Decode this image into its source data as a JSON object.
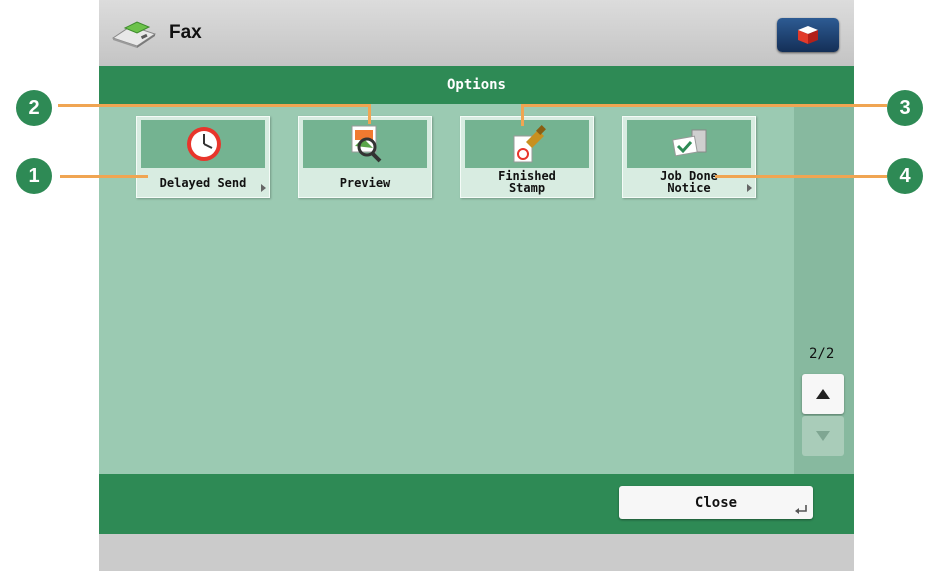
{
  "header": {
    "title": "Fax",
    "app_icon": "fax-machine-icon",
    "status_icon": "cube-icon"
  },
  "options_bar": {
    "title": "Options"
  },
  "tiles": [
    {
      "label": "Delayed Send",
      "icon": "clock-icon",
      "has_submenu": true
    },
    {
      "label": "Preview",
      "icon": "magnifier-icon",
      "has_submenu": false
    },
    {
      "label": "Finished\nStamp",
      "icon": "stamp-icon",
      "has_submenu": false
    },
    {
      "label": "Job Done\nNotice",
      "icon": "notice-icon",
      "has_submenu": true
    }
  ],
  "pagination": {
    "page": "2/2"
  },
  "footer": {
    "close_label": "Close"
  },
  "callouts": [
    "1",
    "2",
    "3",
    "4"
  ],
  "colors": {
    "accent_green": "#2e8a55",
    "panel_green": "#9bcab2",
    "callout_line": "#f0a552"
  }
}
